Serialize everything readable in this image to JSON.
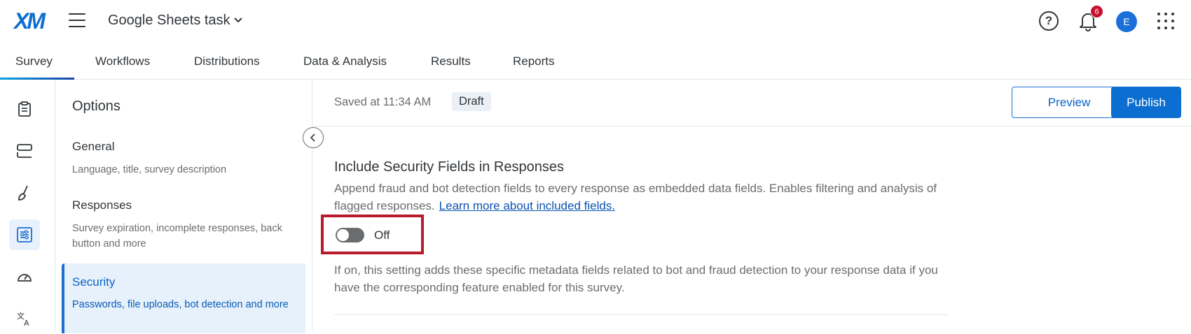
{
  "header": {
    "logo": "XM",
    "project_title": "Google Sheets task",
    "notification_count": "6",
    "avatar_initial": "E"
  },
  "tabs": [
    {
      "label": "Survey",
      "active": true
    },
    {
      "label": "Workflows"
    },
    {
      "label": "Distributions"
    },
    {
      "label": "Data & Analysis"
    },
    {
      "label": "Results"
    },
    {
      "label": "Reports"
    }
  ],
  "rail": {
    "icons": [
      "survey-clipboard-icon",
      "blocks-icon",
      "paintbrush-icon",
      "options-sliders-icon",
      "gauge-icon",
      "translate-icon"
    ],
    "active": "options-sliders-icon"
  },
  "options": {
    "title": "Options",
    "items": [
      {
        "heading": "General",
        "sub": "Language, title, survey description"
      },
      {
        "heading": "Responses",
        "sub": "Survey expiration, incomplete responses, back button and more"
      },
      {
        "heading": "Security",
        "sub": "Passwords, file uploads, bot detection and more",
        "active": true
      }
    ]
  },
  "status": {
    "saved_text": "Saved at 11:34 AM",
    "draft_badge": "Draft",
    "preview_label": "Preview",
    "publish_label": "Publish"
  },
  "section": {
    "title": "Include Security Fields in Responses",
    "description": "Append fraud and bot detection fields to every response as embedded data fields. Enables filtering and analysis of flagged responses.",
    "link_text": "Learn more about included fields.",
    "toggle_state": "Off",
    "note": "If on, this setting adds these specific metadata fields related to bot and fraud detection to your response data if you have the corresponding feature enabled for this survey."
  },
  "colors": {
    "accent": "#0b6ed0",
    "highlight_border": "#b81c2c",
    "active_bg": "#e7f1fb"
  }
}
